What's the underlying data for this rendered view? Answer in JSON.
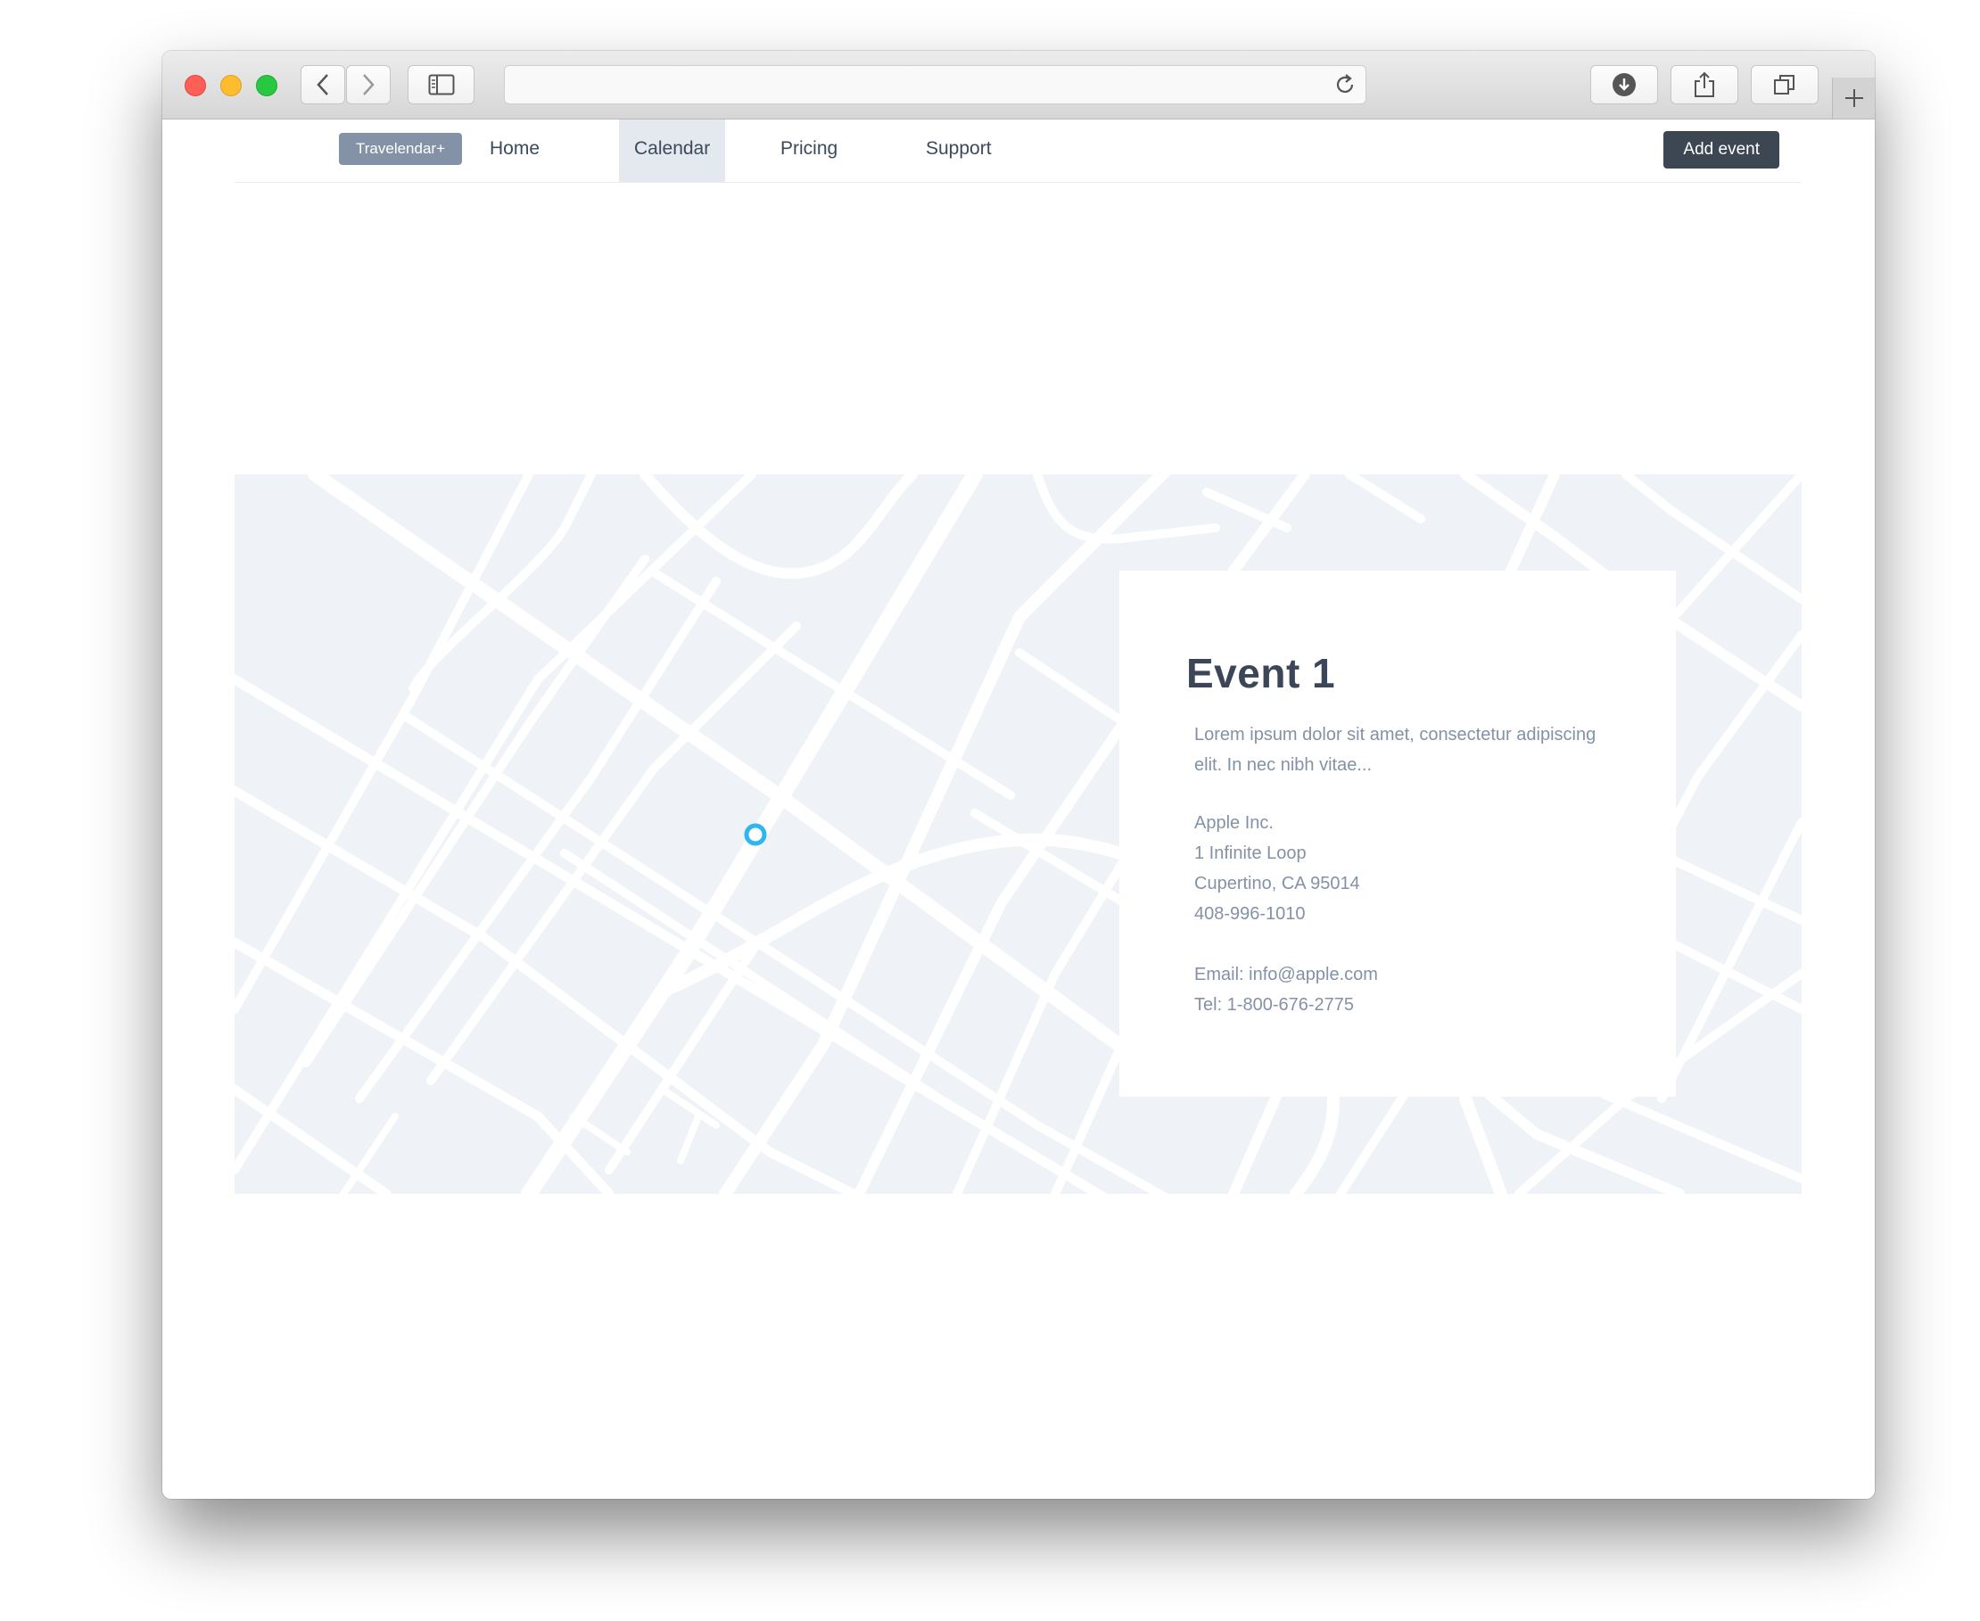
{
  "nav": {
    "brand": "Travelendar+",
    "items": [
      {
        "label": "Home"
      },
      {
        "label": "Calendar",
        "active": true
      },
      {
        "label": "Pricing"
      },
      {
        "label": "Support"
      }
    ],
    "add_event_label": "Add event"
  },
  "browser": {
    "url": "",
    "traffic_lights": {
      "close": "#fe5f57",
      "minimize": "#febc2e",
      "zoom": "#28c840"
    }
  },
  "event": {
    "title": "Event 1",
    "description": "Lorem ipsum dolor sit amet, consectetur adipiscing elit. In nec nibh vitae...",
    "address": [
      "Apple Inc.",
      "1 Infinite Loop",
      "Cupertino, CA 95014",
      "408-996-1010"
    ],
    "email": "Email: info@apple.com",
    "tel": "Tel: 1-800-676-2775"
  },
  "map": {
    "background": "#eff2f7",
    "road_color": "#ffffff",
    "marker_color": "#2fb5f0"
  }
}
